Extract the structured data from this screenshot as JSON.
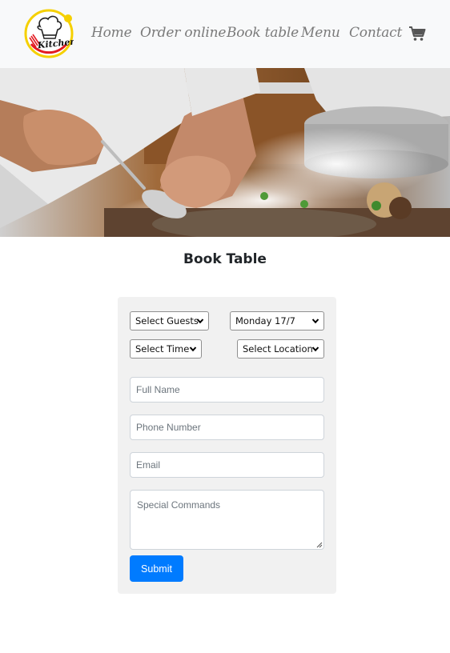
{
  "nav": {
    "logo_text": "Kitchen",
    "links": [
      "Home",
      "Order online",
      "Book table",
      "Menu",
      "Contact"
    ]
  },
  "page": {
    "title": "Book Table"
  },
  "form": {
    "guests": "Select Guests",
    "date": "Monday 17/7",
    "time": "Select Time",
    "location": "Select Location",
    "full_name_placeholder": "Full Name",
    "phone_placeholder": "Phone Number",
    "email_placeholder": "Email",
    "comments_placeholder": "Special Commands",
    "submit_label": "Submit"
  },
  "colors": {
    "navbar_bg": "#f8f9fa",
    "nav_link": "#7a7a7a",
    "card_bg": "#f1f1f1",
    "button": "#007bff"
  }
}
